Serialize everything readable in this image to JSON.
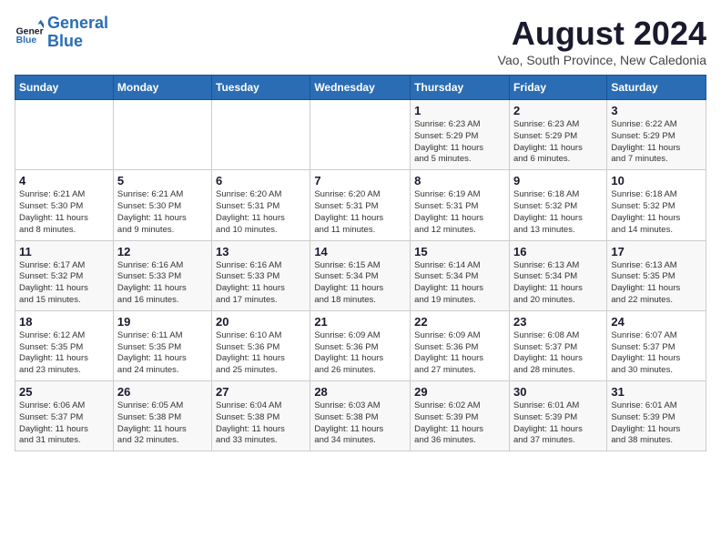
{
  "logo": {
    "line1": "General",
    "line2": "Blue"
  },
  "title": "August 2024",
  "subtitle": "Vao, South Province, New Caledonia",
  "days_of_week": [
    "Sunday",
    "Monday",
    "Tuesday",
    "Wednesday",
    "Thursday",
    "Friday",
    "Saturday"
  ],
  "weeks": [
    [
      {
        "day": "",
        "info": ""
      },
      {
        "day": "",
        "info": ""
      },
      {
        "day": "",
        "info": ""
      },
      {
        "day": "",
        "info": ""
      },
      {
        "day": "1",
        "info": "Sunrise: 6:23 AM\nSunset: 5:29 PM\nDaylight: 11 hours\nand 5 minutes."
      },
      {
        "day": "2",
        "info": "Sunrise: 6:23 AM\nSunset: 5:29 PM\nDaylight: 11 hours\nand 6 minutes."
      },
      {
        "day": "3",
        "info": "Sunrise: 6:22 AM\nSunset: 5:29 PM\nDaylight: 11 hours\nand 7 minutes."
      }
    ],
    [
      {
        "day": "4",
        "info": "Sunrise: 6:21 AM\nSunset: 5:30 PM\nDaylight: 11 hours\nand 8 minutes."
      },
      {
        "day": "5",
        "info": "Sunrise: 6:21 AM\nSunset: 5:30 PM\nDaylight: 11 hours\nand 9 minutes."
      },
      {
        "day": "6",
        "info": "Sunrise: 6:20 AM\nSunset: 5:31 PM\nDaylight: 11 hours\nand 10 minutes."
      },
      {
        "day": "7",
        "info": "Sunrise: 6:20 AM\nSunset: 5:31 PM\nDaylight: 11 hours\nand 11 minutes."
      },
      {
        "day": "8",
        "info": "Sunrise: 6:19 AM\nSunset: 5:31 PM\nDaylight: 11 hours\nand 12 minutes."
      },
      {
        "day": "9",
        "info": "Sunrise: 6:18 AM\nSunset: 5:32 PM\nDaylight: 11 hours\nand 13 minutes."
      },
      {
        "day": "10",
        "info": "Sunrise: 6:18 AM\nSunset: 5:32 PM\nDaylight: 11 hours\nand 14 minutes."
      }
    ],
    [
      {
        "day": "11",
        "info": "Sunrise: 6:17 AM\nSunset: 5:32 PM\nDaylight: 11 hours\nand 15 minutes."
      },
      {
        "day": "12",
        "info": "Sunrise: 6:16 AM\nSunset: 5:33 PM\nDaylight: 11 hours\nand 16 minutes."
      },
      {
        "day": "13",
        "info": "Sunrise: 6:16 AM\nSunset: 5:33 PM\nDaylight: 11 hours\nand 17 minutes."
      },
      {
        "day": "14",
        "info": "Sunrise: 6:15 AM\nSunset: 5:34 PM\nDaylight: 11 hours\nand 18 minutes."
      },
      {
        "day": "15",
        "info": "Sunrise: 6:14 AM\nSunset: 5:34 PM\nDaylight: 11 hours\nand 19 minutes."
      },
      {
        "day": "16",
        "info": "Sunrise: 6:13 AM\nSunset: 5:34 PM\nDaylight: 11 hours\nand 20 minutes."
      },
      {
        "day": "17",
        "info": "Sunrise: 6:13 AM\nSunset: 5:35 PM\nDaylight: 11 hours\nand 22 minutes."
      }
    ],
    [
      {
        "day": "18",
        "info": "Sunrise: 6:12 AM\nSunset: 5:35 PM\nDaylight: 11 hours\nand 23 minutes."
      },
      {
        "day": "19",
        "info": "Sunrise: 6:11 AM\nSunset: 5:35 PM\nDaylight: 11 hours\nand 24 minutes."
      },
      {
        "day": "20",
        "info": "Sunrise: 6:10 AM\nSunset: 5:36 PM\nDaylight: 11 hours\nand 25 minutes."
      },
      {
        "day": "21",
        "info": "Sunrise: 6:09 AM\nSunset: 5:36 PM\nDaylight: 11 hours\nand 26 minutes."
      },
      {
        "day": "22",
        "info": "Sunrise: 6:09 AM\nSunset: 5:36 PM\nDaylight: 11 hours\nand 27 minutes."
      },
      {
        "day": "23",
        "info": "Sunrise: 6:08 AM\nSunset: 5:37 PM\nDaylight: 11 hours\nand 28 minutes."
      },
      {
        "day": "24",
        "info": "Sunrise: 6:07 AM\nSunset: 5:37 PM\nDaylight: 11 hours\nand 30 minutes."
      }
    ],
    [
      {
        "day": "25",
        "info": "Sunrise: 6:06 AM\nSunset: 5:37 PM\nDaylight: 11 hours\nand 31 minutes."
      },
      {
        "day": "26",
        "info": "Sunrise: 6:05 AM\nSunset: 5:38 PM\nDaylight: 11 hours\nand 32 minutes."
      },
      {
        "day": "27",
        "info": "Sunrise: 6:04 AM\nSunset: 5:38 PM\nDaylight: 11 hours\nand 33 minutes."
      },
      {
        "day": "28",
        "info": "Sunrise: 6:03 AM\nSunset: 5:38 PM\nDaylight: 11 hours\nand 34 minutes."
      },
      {
        "day": "29",
        "info": "Sunrise: 6:02 AM\nSunset: 5:39 PM\nDaylight: 11 hours\nand 36 minutes."
      },
      {
        "day": "30",
        "info": "Sunrise: 6:01 AM\nSunset: 5:39 PM\nDaylight: 11 hours\nand 37 minutes."
      },
      {
        "day": "31",
        "info": "Sunrise: 6:01 AM\nSunset: 5:39 PM\nDaylight: 11 hours\nand 38 minutes."
      }
    ]
  ]
}
